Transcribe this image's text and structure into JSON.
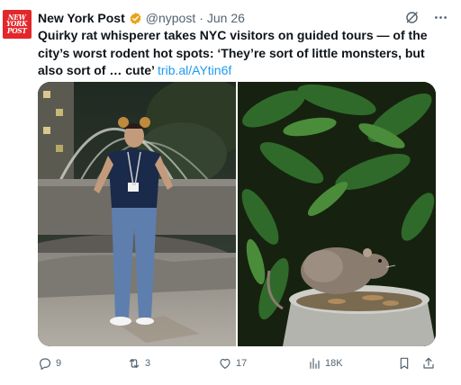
{
  "account": {
    "name": "New York Post",
    "handle": "@nypost",
    "separator": "·",
    "date": "Jun 26",
    "avatar_lines": [
      "NEW",
      "YORK",
      "POST"
    ],
    "verified_color": "#e8a317"
  },
  "tweet": {
    "text": "Quirky rat whisperer takes NYC visitors on guided tours — of the city’s worst rodent hot spots: ‘They’re sort of little monsters, but also sort of … cute’",
    "link": "trib.al/AYtin6f"
  },
  "media": [
    {
      "icon": "photo-woman-fountain"
    },
    {
      "icon": "photo-rat-planter"
    }
  ],
  "actions": {
    "replies": "9",
    "reposts": "3",
    "likes": "17",
    "views": "18K"
  },
  "colors": {
    "brand_red": "#e3262a",
    "link_blue": "#1d9bf0",
    "muted": "#536471"
  }
}
